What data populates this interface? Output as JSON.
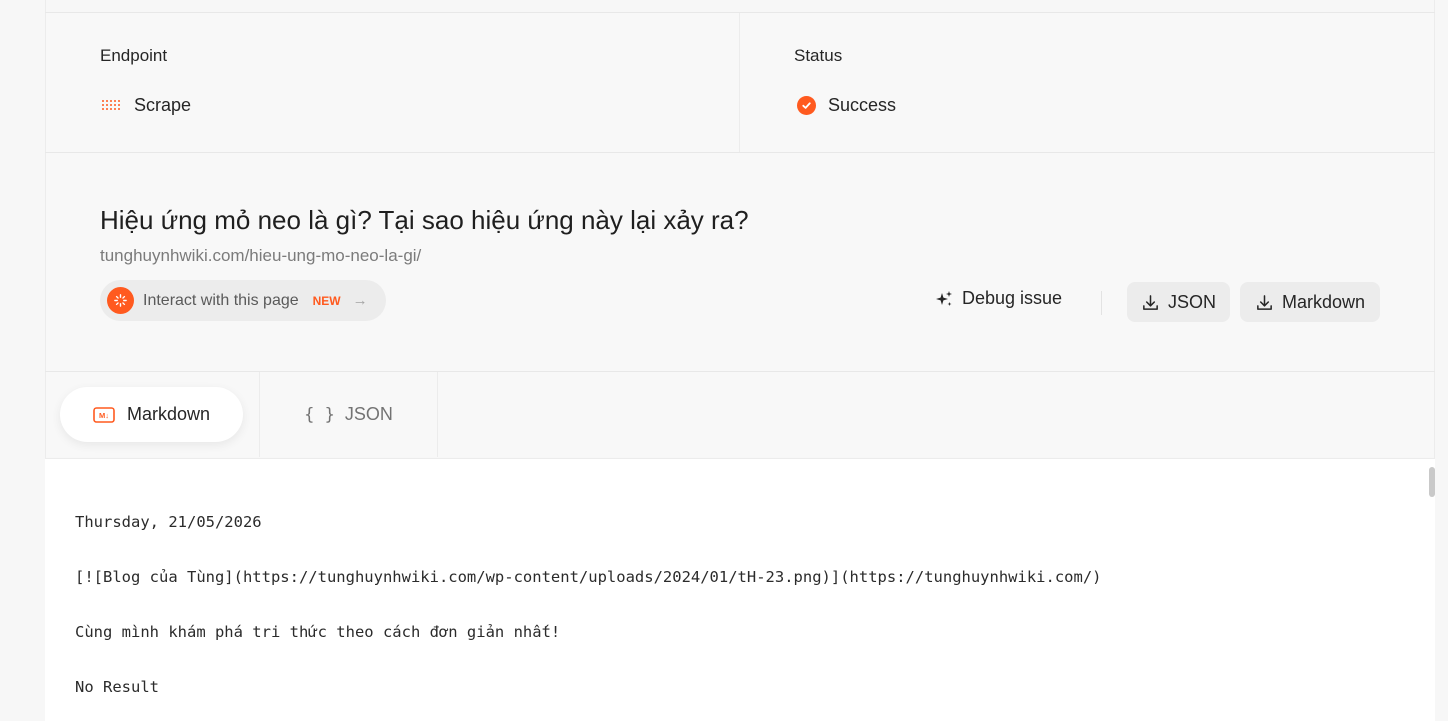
{
  "info": {
    "endpoint_label": "Endpoint",
    "endpoint_value": "Scrape",
    "endpoint_icon": "scrape-dots-icon",
    "status_label": "Status",
    "status_value": "Success",
    "status_icon": "check-circle-icon",
    "accent_color": "#ff5a1f"
  },
  "page": {
    "title": "Hiệu ứng mỏ neo là gì? Tại sao hiệu ứng này lại xảy ra?",
    "url": "tunghuynhwiki.com/hieu-ung-mo-neo-la-gi/",
    "interact_label": "Interact with this page",
    "interact_badge": "NEW",
    "interact_arrow": "→",
    "debug_label": "Debug issue",
    "download_json_label": "JSON",
    "download_markdown_label": "Markdown"
  },
  "tabs": {
    "markdown_label": "Markdown",
    "json_label": "JSON",
    "json_icon": "{ }"
  },
  "content": {
    "lines": [
      "Thursday, 21/05/2026",
      "[![Blog của Tùng](https://tunghuynhwiki.com/wp-content/uploads/2024/01/tH-23.png)](https://tunghuynhwiki.com/)",
      "Cùng mình khám phá tri thức theo cách đơn giản nhất!",
      "No Result"
    ]
  }
}
